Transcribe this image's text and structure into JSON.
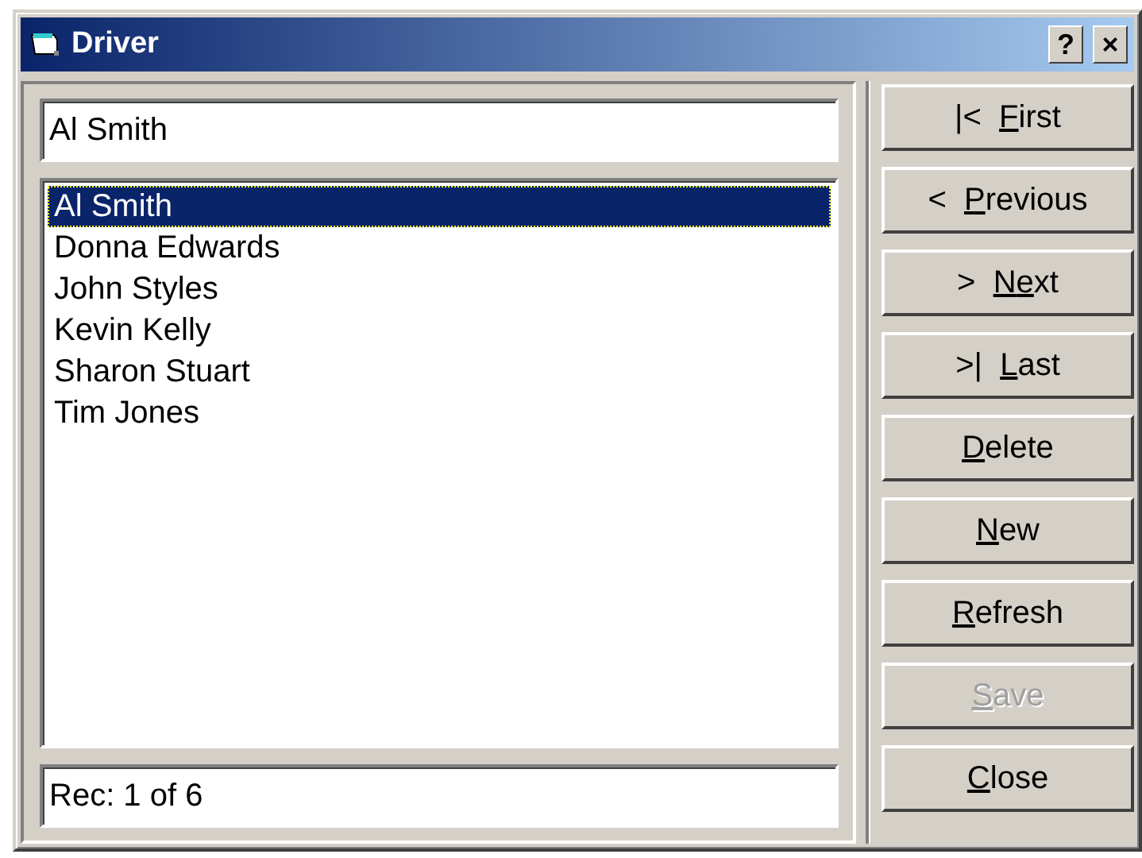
{
  "window": {
    "title": "Driver",
    "help_button": "?",
    "close_button": "×"
  },
  "name_field": {
    "value": "Al Smith"
  },
  "drivers": [
    {
      "name": "Al Smith",
      "selected": true
    },
    {
      "name": "Donna Edwards",
      "selected": false
    },
    {
      "name": "John Styles",
      "selected": false
    },
    {
      "name": "Kevin Kelly",
      "selected": false
    },
    {
      "name": "Sharon Stuart",
      "selected": false
    },
    {
      "name": "Tim Jones",
      "selected": false
    }
  ],
  "record_field": {
    "value": "Rec: 1 of 6"
  },
  "buttons": [
    {
      "prefix": "|<  ",
      "key": "F",
      "rest": "irst",
      "disabled": false
    },
    {
      "prefix": "<  ",
      "key": "P",
      "rest": "revious",
      "disabled": false
    },
    {
      "prefix": ">  ",
      "key": "N",
      "key2": "e",
      "rest2": "xt",
      "disabled": false
    },
    {
      "prefix": ">|  ",
      "key": "L",
      "rest": "ast",
      "disabled": false
    },
    {
      "key": "D",
      "rest": "elete",
      "disabled": false
    },
    {
      "key": "N",
      "rest": "ew",
      "disabled": false
    },
    {
      "key": "R",
      "rest": "efresh",
      "disabled": false
    },
    {
      "key": "S",
      "rest": "ave",
      "disabled": true
    },
    {
      "key": "C",
      "rest": "lose",
      "disabled": false
    }
  ]
}
